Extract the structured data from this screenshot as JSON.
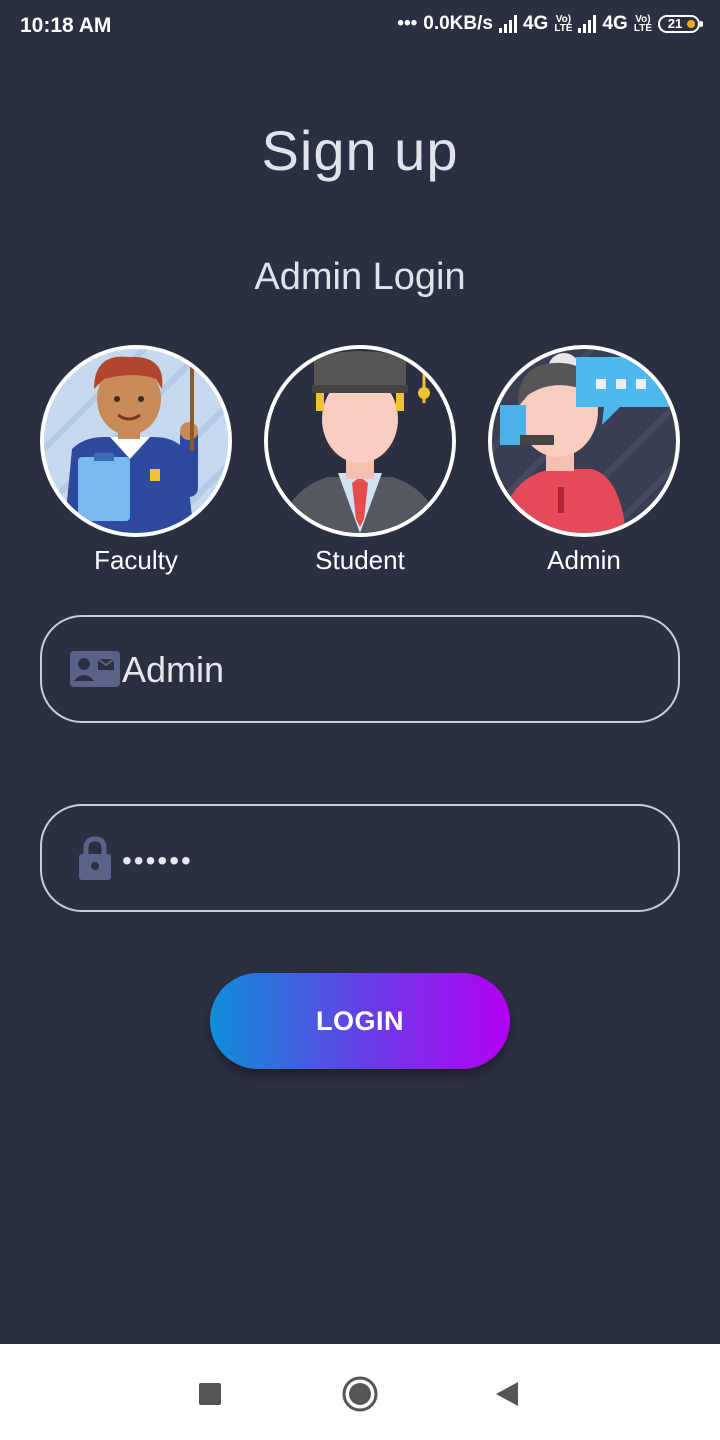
{
  "status_bar": {
    "time": "10:18 AM",
    "network_speed": "0.0KB/s",
    "sim1_network": "4G",
    "sim2_network": "4G",
    "volte_label": "Vo)) LTE",
    "battery_level": "21"
  },
  "header": {
    "title": "Sign up",
    "subtitle": "Admin Login"
  },
  "roles": [
    {
      "label": "Faculty",
      "icon": "faculty-avatar-icon"
    },
    {
      "label": "Student",
      "icon": "student-avatar-icon"
    },
    {
      "label": "Admin",
      "icon": "admin-avatar-icon"
    }
  ],
  "form": {
    "username_value": "Admin",
    "username_icon": "id-card-icon",
    "password_value": "••••••",
    "password_icon": "lock-icon",
    "login_label": "LOGIN"
  },
  "nav_bar": {
    "icons": [
      "recents-square-icon",
      "home-circle-icon",
      "back-triangle-icon"
    ]
  },
  "colors": {
    "background": "#2b2f42",
    "button_gradient_start": "#0e8fd8",
    "button_gradient_end": "#b400f5",
    "field_border": "#c9ccd6"
  }
}
